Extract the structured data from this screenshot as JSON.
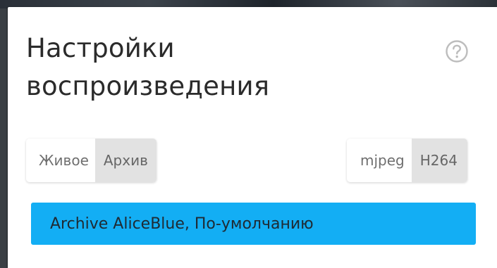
{
  "dialog": {
    "title_line1": "Настройки",
    "title_line2": "воспроизведения",
    "help_icon": "question-circle-icon"
  },
  "mode_toggle": {
    "options": [
      "Живое",
      "Архив"
    ],
    "selected": "Архив"
  },
  "codec_toggle": {
    "options": [
      "mjpeg",
      "H264"
    ],
    "selected": "H264"
  },
  "archive_select": {
    "value": "Archive AliceBlue, По-умолчанию"
  },
  "colors": {
    "accent": "#13aef4",
    "selected_segment": "#e2e2e2",
    "panel": "#ffffff",
    "title_text": "#2b2b2b"
  }
}
